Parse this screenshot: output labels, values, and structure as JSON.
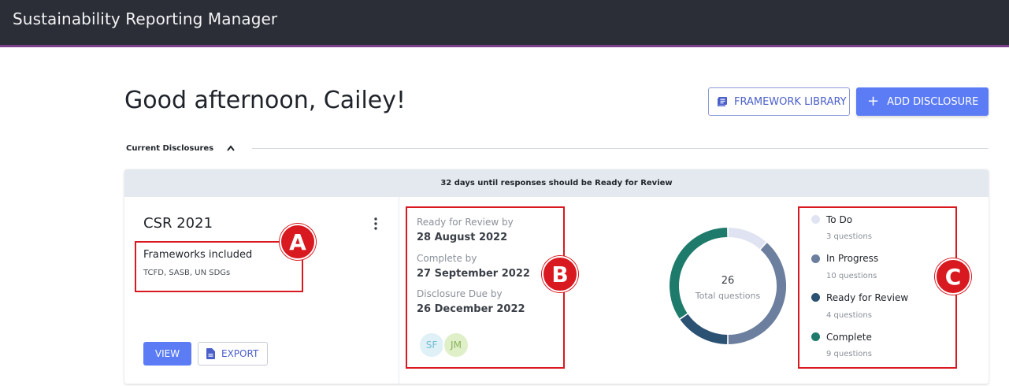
{
  "app": {
    "title": "Sustainability Reporting Manager"
  },
  "header": {
    "greeting": "Good afternoon, Cailey!",
    "framework_library_label": "FRAMEWORK LIBRARY",
    "add_disclosure_label": "ADD DISCLOSURE"
  },
  "section": {
    "label": "Current Disclosures"
  },
  "card": {
    "banner": "32 days until responses should be Ready for Review",
    "title": "CSR 2021",
    "frameworks_label": "Frameworks included",
    "frameworks": "TCFD, SASB, UN SDGs",
    "view_label": "VIEW",
    "export_label": "EXPORT",
    "dates": [
      {
        "label": "Ready for Review by",
        "value": "28 August 2022"
      },
      {
        "label": "Complete by",
        "value": "27 September 2022"
      },
      {
        "label": "Disclosure Due by",
        "value": "26 December 2022"
      }
    ],
    "avatars": [
      "SF",
      "JM"
    ],
    "total": {
      "value": "26",
      "label": "Total questions"
    },
    "status": [
      {
        "name": "To Do",
        "count_text": "3 questions",
        "count": 3,
        "color": "#dfe3f2"
      },
      {
        "name": "In Progress",
        "count_text": "10 questions",
        "count": 10,
        "color": "#6c7f9e"
      },
      {
        "name": "Ready for Review",
        "count_text": "4 questions",
        "count": 4,
        "color": "#2c5273"
      },
      {
        "name": "Complete",
        "count_text": "9 questions",
        "count": 9,
        "color": "#1e7b6b"
      }
    ]
  },
  "annotations": [
    "A",
    "B",
    "C"
  ],
  "colors": {
    "accent": "#5b7cf5",
    "highlight": "#d81920",
    "topbar": "#2b2e36"
  }
}
